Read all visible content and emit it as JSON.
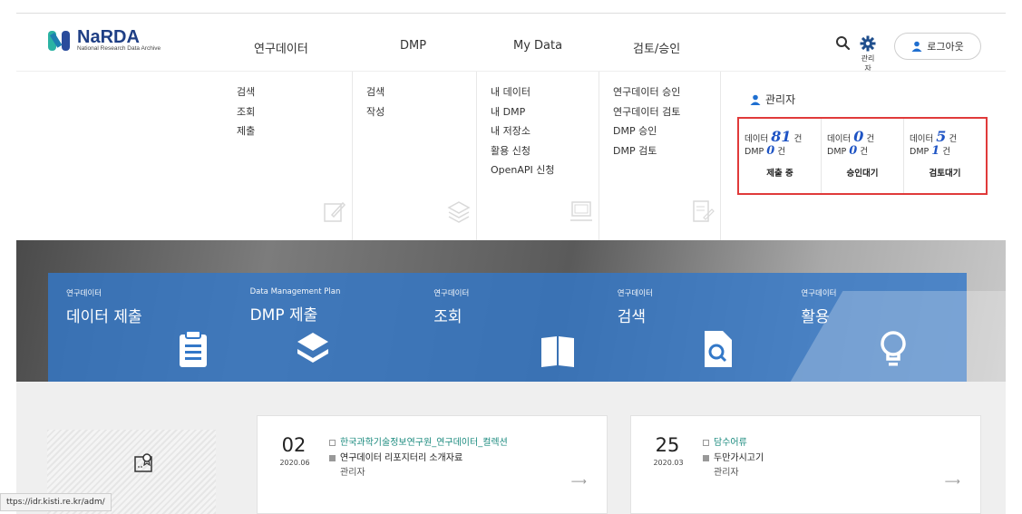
{
  "logo": {
    "name": "NaRDA",
    "tagline": "National Research Data Archive"
  },
  "gnb": [
    "연구데이터",
    "DMP",
    "My Data",
    "검토/승인"
  ],
  "header": {
    "admin_label": "관리자",
    "logout_label": "로그아웃"
  },
  "menus": [
    {
      "items": [
        "검색",
        "조회",
        "제출"
      ]
    },
    {
      "items": [
        "검색",
        "작성"
      ]
    },
    {
      "items": [
        "내 데이터",
        "내 DMP",
        "내 저장소",
        "활용 신청",
        "OpenAPI 신청"
      ]
    },
    {
      "items": [
        "연구데이터 승인",
        "연구데이터 검토",
        "DMP 승인",
        "DMP 검토"
      ]
    }
  ],
  "admin_panel": {
    "title": "관리자",
    "stats": [
      {
        "data_label": "데이터",
        "data_count": "81",
        "dmp_label": "DMP",
        "dmp_count": "0",
        "unit": "건",
        "caption": "제출 중"
      },
      {
        "data_label": "데이터",
        "data_count": "0",
        "dmp_label": "DMP",
        "dmp_count": "0",
        "unit": "건",
        "caption": "승인대기"
      },
      {
        "data_label": "데이터",
        "data_count": "5",
        "dmp_label": "DMP",
        "dmp_count": "1",
        "unit": "건",
        "caption": "검토대기"
      }
    ]
  },
  "tiles": [
    {
      "sub": "연구데이터",
      "main": "데이터 제출",
      "icon": "clipboard-icon"
    },
    {
      "sub": "Data Management Plan",
      "main": "DMP 제출",
      "icon": "layers-icon"
    },
    {
      "sub": "연구데이터",
      "main": "조회",
      "icon": "book-icon"
    },
    {
      "sub": "연구데이터",
      "main": "검색",
      "icon": "doc-search-icon"
    },
    {
      "sub": "연구데이터",
      "main": "활용",
      "icon": "lightbulb-icon"
    }
  ],
  "notices": [
    {
      "day": "02",
      "ym": "2020.06",
      "category": "한국과학기술정보연구원_연구데이터_컬렉션",
      "title": "연구데이터 리포지터리 소개자료",
      "author": "관리자"
    },
    {
      "day": "25",
      "ym": "2020.03",
      "category": "담수어류",
      "title": "두만가시고기",
      "author": "관리자"
    }
  ],
  "status_url": "ttps://idr.kisti.re.kr/adm/",
  "colors": {
    "accent": "#1f54c4",
    "tile": "#3378c8",
    "highlight": "#e03a3a"
  }
}
